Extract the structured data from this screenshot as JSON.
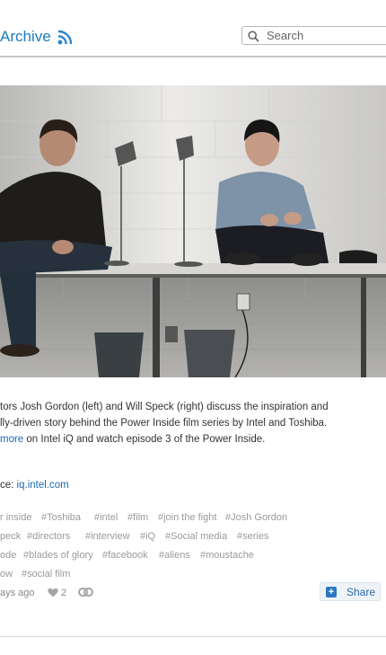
{
  "header": {
    "archive_label": "Archive",
    "rss_icon": "rss-icon",
    "search": {
      "placeholder": "Search",
      "value": "",
      "icon": "search-icon"
    }
  },
  "photo": {
    "description_icon": "photo-of-two-men-seated-on-table-with-lamps"
  },
  "caption": {
    "line1": "tors Josh Gordon (left) and Will Speck (right) discuss the inspiration and",
    "line2": "lly-driven story behind the Power Inside film series by Intel and Toshiba.",
    "line3_link": "more",
    "line3_rest": " on Intel iQ and watch episode 3 of the Power Inside."
  },
  "source": {
    "prefix": "ce: ",
    "link": "iq.intel.com"
  },
  "tags": [
    [
      "r inside",
      "#Toshiba",
      "#intel",
      "#film",
      "#join the fight",
      "#Josh Gordon"
    ],
    [
      "peck",
      "#directors",
      "#interview",
      "#iQ",
      "#Social media",
      "#series"
    ],
    [
      "ode",
      "#blades of glory",
      "#facebook",
      "#aliens",
      "#moustache"
    ],
    [
      "ow",
      "#social film"
    ]
  ],
  "meta": {
    "time": "ays ago",
    "likes": "2",
    "heart_icon": "heart-icon",
    "link_icon": "permalink-icon"
  },
  "share": {
    "label": "Share",
    "icon": "plus-icon"
  },
  "colors": {
    "link": "#1a7bbf",
    "tag": "#9a9a9a",
    "share_bg": "#eef3f8"
  }
}
